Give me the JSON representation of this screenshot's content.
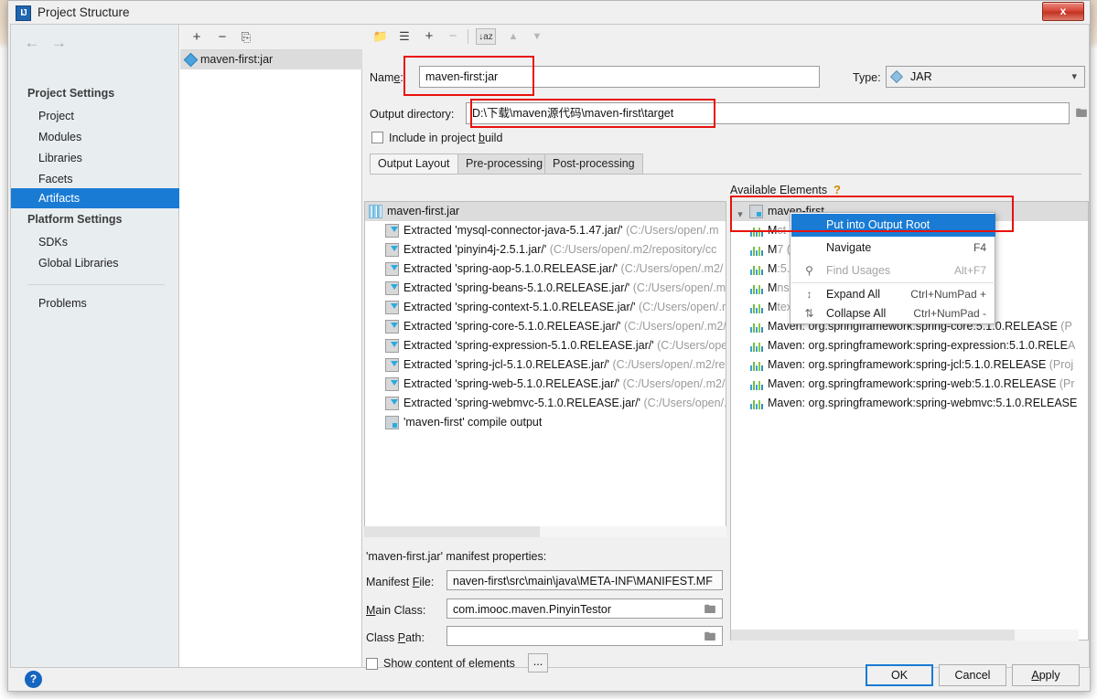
{
  "window": {
    "title": "Project Structure",
    "app_icon": "IJ",
    "close_label": "x",
    "close_icon": "close-icon"
  },
  "sidebar": {
    "back_icon": "arrow-left-icon",
    "forward_icon": "arrow-right-icon",
    "groups": [
      {
        "label": "Project Settings",
        "items": [
          "Project",
          "Modules",
          "Libraries",
          "Facets",
          "Artifacts"
        ]
      },
      {
        "label": "Platform Settings",
        "items": [
          "SDKs",
          "Global Libraries"
        ]
      }
    ],
    "selected": "Artifacts",
    "problems_label": "Problems"
  },
  "artifacts_panel": {
    "toolbar": [
      {
        "name": "add-artifact-button",
        "glyph": "+"
      },
      {
        "name": "remove-artifact-button",
        "glyph": "−"
      },
      {
        "name": "copy-artifact-button",
        "glyph": "⎘"
      }
    ],
    "items": [
      {
        "label": "maven-first:jar",
        "icon": "artifact-jar-icon",
        "selected": true
      }
    ]
  },
  "form": {
    "name_label": "Name:",
    "name_label_pre": "Nam",
    "name_label_key": "e",
    "name_label_post": ":",
    "name_value": "maven-first:jar",
    "type_label": "Type:",
    "type_value": "JAR",
    "output_dir_label": "Output directory:",
    "output_dir_value": "D:\\下载\\maven源代码\\maven-first\\target",
    "include_in_build_pre": "Include in project ",
    "include_in_build_key": "b",
    "include_in_build_post": "uild",
    "include_in_build_checked": false
  },
  "tabs": {
    "items": [
      "Output Layout",
      "Pre-processing",
      "Post-processing"
    ],
    "active": "Output Layout"
  },
  "layout_toolbar": [
    {
      "name": "add-directory-button",
      "glyph": "◧"
    },
    {
      "name": "add-archive-button",
      "glyph": "‖"
    },
    {
      "name": "add-copy-of-button",
      "glyph": "+"
    },
    {
      "name": "remove-element-button",
      "glyph": "−"
    },
    {
      "name": "sort-by-name-button",
      "glyph": "↓az"
    },
    {
      "name": "move-up-button",
      "glyph": "▲"
    },
    {
      "name": "move-down-button",
      "glyph": "▼"
    }
  ],
  "output_tree": {
    "root": {
      "label": "maven-first.jar",
      "icon": "jar-icon"
    },
    "children": [
      {
        "name": "Extracted 'mysql-connector-java-5.1.47.jar/'",
        "path": "(C:/Users/open/.m",
        "icon": "extracted-jar-icon"
      },
      {
        "name": "Extracted 'pinyin4j-2.5.1.jar/'",
        "path": "(C:/Users/open/.m2/repository/cc",
        "icon": "extracted-jar-icon"
      },
      {
        "name": "Extracted 'spring-aop-5.1.0.RELEASE.jar/'",
        "path": "(C:/Users/open/.m2/",
        "icon": "extracted-jar-icon"
      },
      {
        "name": "Extracted 'spring-beans-5.1.0.RELEASE.jar/'",
        "path": "(C:/Users/open/.m",
        "icon": "extracted-jar-icon"
      },
      {
        "name": "Extracted 'spring-context-5.1.0.RELEASE.jar/'",
        "path": "(C:/Users/open/.r",
        "icon": "extracted-jar-icon"
      },
      {
        "name": "Extracted 'spring-core-5.1.0.RELEASE.jar/'",
        "path": "(C:/Users/open/.m2/",
        "icon": "extracted-jar-icon"
      },
      {
        "name": "Extracted 'spring-expression-5.1.0.RELEASE.jar/'",
        "path": "(C:/Users/ope",
        "icon": "extracted-jar-icon"
      },
      {
        "name": "Extracted 'spring-jcl-5.1.0.RELEASE.jar/'",
        "path": "(C:/Users/open/.m2/re",
        "icon": "extracted-jar-icon"
      },
      {
        "name": "Extracted 'spring-web-5.1.0.RELEASE.jar/'",
        "path": "(C:/Users/open/.m2/",
        "icon": "extracted-jar-icon"
      },
      {
        "name": "Extracted 'spring-webmvc-5.1.0.RELEASE.jar/'",
        "path": "(C:/Users/open/.",
        "icon": "extracted-jar-icon"
      },
      {
        "name": "'maven-first' compile output",
        "path": "",
        "icon": "compile-output-icon"
      }
    ]
  },
  "available_panel": {
    "title": "Available Elements",
    "help_glyph": "?",
    "root": {
      "label": "maven-first",
      "icon": "module-icon",
      "expanded": true
    },
    "children": [
      {
        "label": "M",
        "tail": "ct Library)",
        "icon": "library-icon"
      },
      {
        "label": "M",
        "tail": "7 (Project Library)",
        "icon": "library-icon"
      },
      {
        "label": "M",
        "tail": ":5.1.0.RELEASE (Pr",
        "icon": "library-icon"
      },
      {
        "label": "M",
        "tail": "ns:5.1.0.RELEASE (",
        "icon": "library-icon"
      },
      {
        "label": "M",
        "tail": "text:5.1.0.RELEASE",
        "icon": "library-icon"
      },
      {
        "label": "Maven: org.springframework:spring-core:5.1.0.RELEASE",
        "tail": " (P",
        "icon": "library-icon"
      },
      {
        "label": "Maven: org.springframework:spring-expression:5.1.0.RELE",
        "tail": "A",
        "icon": "library-icon"
      },
      {
        "label": "Maven: org.springframework:spring-jcl:5.1.0.RELEASE",
        "tail": " (Proj",
        "icon": "library-icon"
      },
      {
        "label": "Maven: org.springframework:spring-web:5.1.0.RELEASE",
        "tail": " (Pr",
        "icon": "library-icon"
      },
      {
        "label": "Maven: org.springframework:spring-webmvc:5.1.0.RELEASE",
        "tail": "",
        "icon": "library-icon"
      }
    ]
  },
  "context_menu": {
    "items": [
      {
        "label": "Put into Output Root",
        "accel": "",
        "icon": "",
        "highlighted": true,
        "disabled": false
      },
      {
        "label": "Navigate",
        "accel": "F4",
        "icon": "",
        "highlighted": false,
        "disabled": false
      },
      {
        "label": "Find Usages",
        "accel": "Alt+F7",
        "icon": "search-icon",
        "highlighted": false,
        "disabled": true
      },
      {
        "label": "Expand All",
        "accel": "Ctrl+NumPad +",
        "icon": "expand-all-icon",
        "highlighted": false,
        "disabled": false
      },
      {
        "label": "Collapse All",
        "accel": "Ctrl+NumPad -",
        "icon": "collapse-all-icon",
        "highlighted": false,
        "disabled": false
      }
    ]
  },
  "manifest": {
    "title": "'maven-first.jar' manifest properties:",
    "rows": [
      {
        "label_pre": "Manifest ",
        "label_key": "F",
        "label_post": "ile:",
        "value": "naven-first\\src\\main\\java\\META-INF\\MANIFEST.MF",
        "has_browse": false
      },
      {
        "label_pre": "",
        "label_key": "M",
        "label_post": "ain Class:",
        "value": "com.imooc.maven.PinyinTestor",
        "has_browse": true
      },
      {
        "label_pre": "Class ",
        "label_key": "P",
        "label_post": "ath:",
        "value": "",
        "has_browse": true
      }
    ],
    "show_content_label": "Show content of elements",
    "show_content_checked": false,
    "ellipsis_button": "..."
  },
  "buttons": {
    "ok": "OK",
    "cancel": "Cancel",
    "apply_pre": "",
    "apply_key": "A",
    "apply_post": "pply",
    "help_glyph": "?"
  },
  "colors": {
    "accent": "#1a7bd4",
    "highlight_box": "#e8120e",
    "selection": "#1a7bd4",
    "dialog_bg": "#f0f0f0",
    "tree_selected": "#dcdcdc"
  }
}
